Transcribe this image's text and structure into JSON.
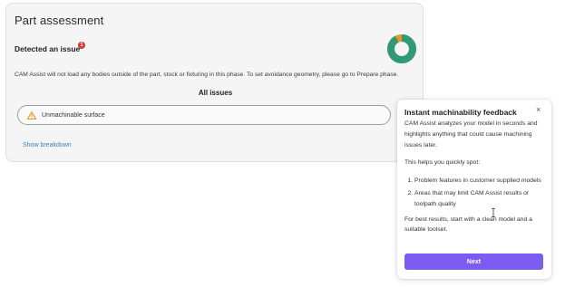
{
  "assessment": {
    "title": "Part assessment",
    "issue_heading": "Detected an issue",
    "issue_count": "1",
    "info": "CAM Assist will not load any bodies outside of the part, stock or fixturing in this phase. To set avoidance geometry, please go to Prepare phase.",
    "all_issues_label": "All issues",
    "issues": [
      {
        "icon": "warning-triangle-icon",
        "label": "Unmachinable surface"
      }
    ],
    "breakdown_link": "Show breakdown",
    "donut": {
      "fraction": 0.92,
      "colors": {
        "primary": "#2e9b74",
        "secondary": "#e8932d"
      }
    }
  },
  "popover": {
    "title": "Instant machinability feedback",
    "intro": "CAM Assist analyzes your model in seconds and highlights anything that could cause machining issues later.",
    "lead": "This helps you quickly spot:",
    "list": [
      "Problem features in customer supplied models",
      "Areas that may limit CAM Assist results or toolpath quality"
    ],
    "footer": "For best results, start with a clean model and a suitable toolset.",
    "next_label": "Next",
    "close_icon": "×"
  },
  "colors": {
    "accent": "#7a5cf0",
    "badge": "#d63b2f",
    "warning": "#e8932d",
    "link": "#3d7fc8"
  }
}
